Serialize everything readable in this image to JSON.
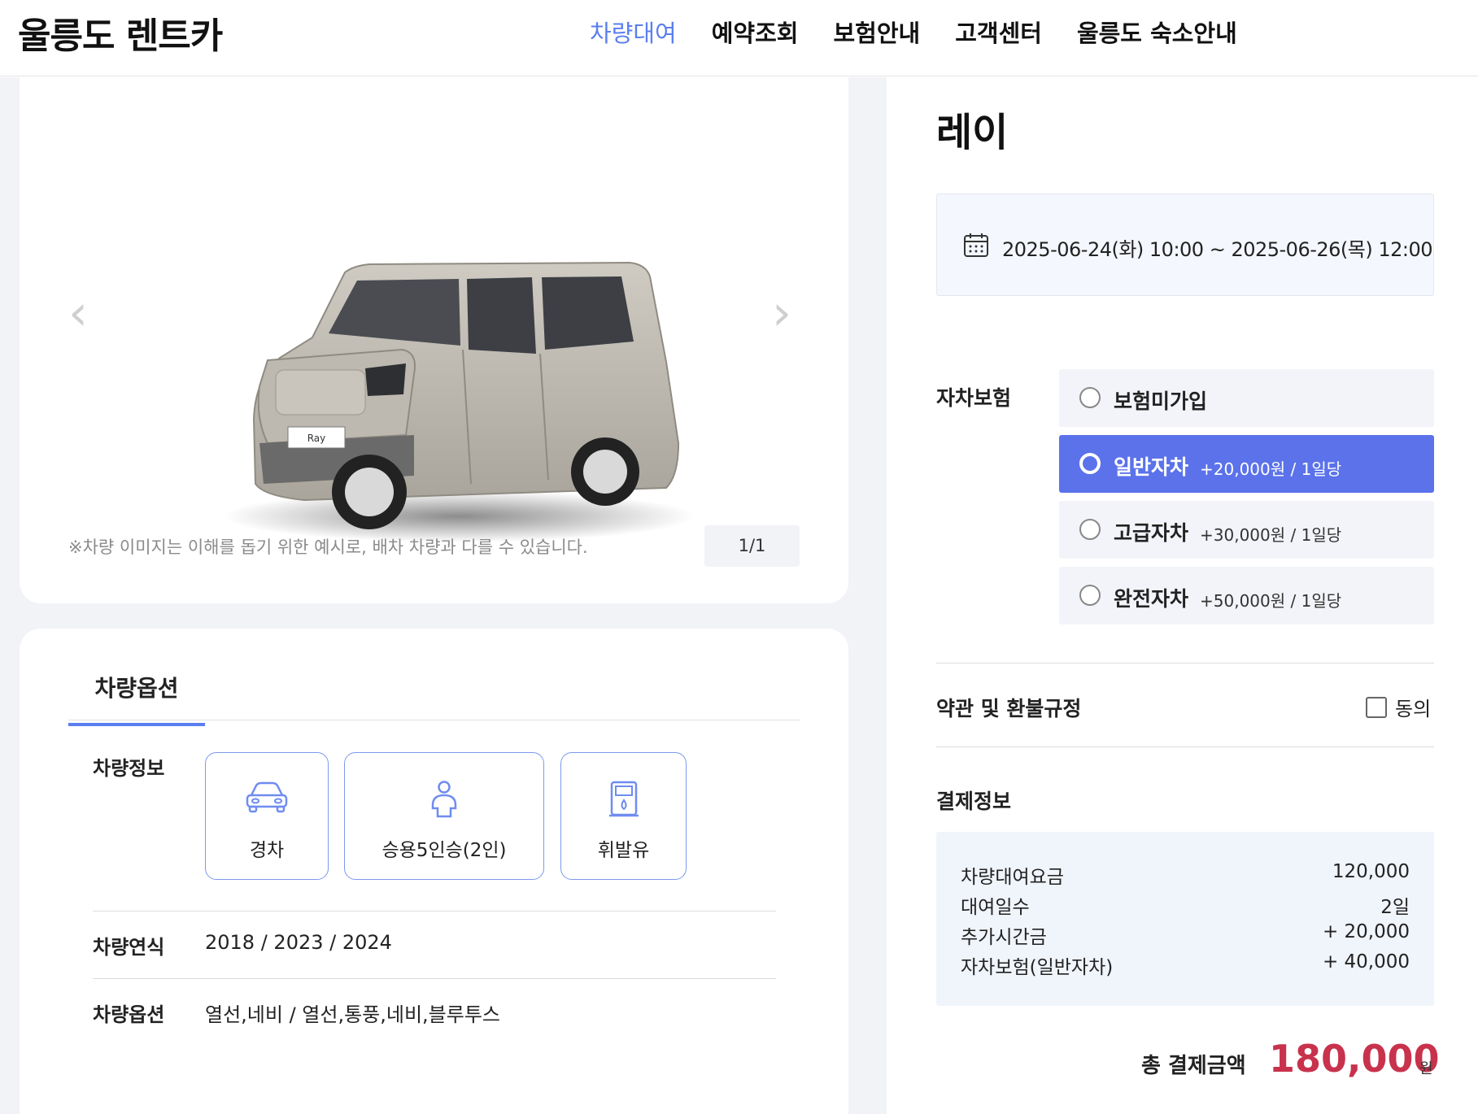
{
  "header": {
    "logo": "울릉도 렌트카",
    "nav": [
      "차량대여",
      "예약조회",
      "보험안내",
      "고객센터",
      "울릉도 숙소안내"
    ],
    "active_nav": "차량대여"
  },
  "gallery": {
    "note": "※차량 이미지는 이해를 돕기 위한 예시로, 배차 차량과 다를 수 있습니다.",
    "counter": "1/1",
    "plate_text": "Ray"
  },
  "options": {
    "tab": "차량옵션",
    "spec_label": "차량정보",
    "specs": [
      {
        "icon": "car-icon",
        "text": "경차"
      },
      {
        "icon": "person-icon",
        "text": "승용5인승(2인)"
      },
      {
        "icon": "fuel-pump-icon",
        "text": "휘발유"
      }
    ],
    "year_label": "차량연식",
    "year_value": "2018 / 2023 / 2024",
    "option_label": "차량옵션",
    "option_value": "열선,네비 / 열선,통풍,네비,블루투스"
  },
  "booking": {
    "car_name": "레이",
    "date_range": "2025-06-24(화) 10:00 ~ 2025-06-26(목) 12:00",
    "insurance_label": "자차보험",
    "insurance_options": [
      {
        "name": "보험미가입",
        "price": ""
      },
      {
        "name": "일반자차",
        "price": "+20,000원 / 1일당"
      },
      {
        "name": "고급자차",
        "price": "+30,000원 / 1일당"
      },
      {
        "name": "완전자차",
        "price": "+50,000원 / 1일당"
      }
    ],
    "selected_insurance": "일반자차",
    "terms_label": "약관 및 환불규정",
    "agree_label": "동의",
    "payment_label": "결제정보",
    "payment_rows": [
      {
        "label": "차량대여요금",
        "value": "120,000"
      },
      {
        "label": "대여일수",
        "value": "2일"
      },
      {
        "label": "추가시간금",
        "value": "+ 20,000"
      },
      {
        "label": "자차보험(일반자차)",
        "value": "+ 40,000"
      }
    ],
    "total_label": "총 결제금액",
    "total_amount": "180,000",
    "total_unit": "원"
  },
  "colors": {
    "accent": "#5b7ef0",
    "selected_bg": "#5b72ea",
    "total": "#c8324c"
  }
}
